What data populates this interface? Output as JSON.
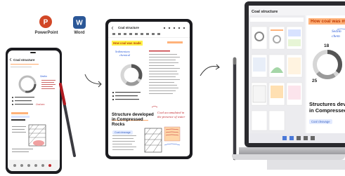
{
  "apps": {
    "powerpoint": {
      "label": "PowerPoint",
      "letter": "P",
      "color": "#d24726"
    },
    "word": {
      "label": "Word",
      "letter": "W",
      "color": "#2b5797"
    }
  },
  "phone": {
    "note_title": "Coal structure"
  },
  "tablet": {
    "note_title": "Coal structure",
    "headline": "How coal was made",
    "structure_text": "Structure developed in Compressed Rocks",
    "chip_text": "Coal cleavage",
    "handwriting": "Coal accumulated in the presence of water"
  },
  "laptop": {
    "note_title": "Coal structure",
    "headline": "How coal was ma",
    "handwriting": "Sedim chem",
    "numbers": [
      "18",
      "25"
    ],
    "structure_text_line1": "Structures deve",
    "structure_text_line2": "in Compressed",
    "chip_text": "Coal cleavage"
  },
  "colors": {
    "device_frame": "#1b1b1f",
    "highlight_yellow": "#fff24a",
    "highlight_orange": "#ffb27a",
    "accent_red": "#c2272d",
    "accent_blue": "#2b5bd8"
  }
}
